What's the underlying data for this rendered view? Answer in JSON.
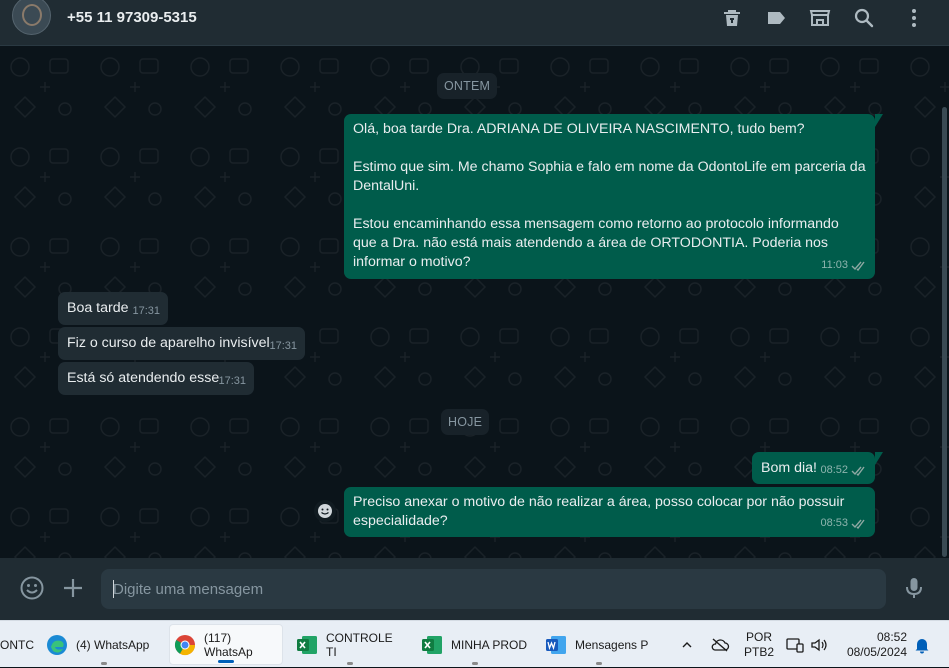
{
  "header": {
    "contact_name": "+55 11 97309-5315",
    "icons": [
      "archive-icon",
      "label-icon",
      "store-icon",
      "search-icon",
      "menu-icon"
    ]
  },
  "chat": {
    "date_yesterday": "ONTEM",
    "date_today": "HOJE",
    "messages": [
      {
        "dir": "out",
        "text": "Olá, boa tarde Dra. ADRIANA DE OLIVEIRA NASCIMENTO, tudo bem?\n\nEstimo que sim. Me chamo Sophia e falo em nome da OdontoLife em parceria da DentalUni.\n\nEstou encaminhando essa mensagem como retorno ao protocolo informando que a Dra. não está mais atendendo a área de ORTODONTIA. Poderia nos informar o motivo?",
        "time": "11:03"
      },
      {
        "dir": "in",
        "text": "Boa tarde",
        "time": "17:31"
      },
      {
        "dir": "in",
        "text": "Fiz o curso de aparelho invisível",
        "time": "17:31"
      },
      {
        "dir": "in",
        "text": "Está só atendendo esse",
        "time": "17:31"
      },
      {
        "dir": "out",
        "text": "Bom dia!",
        "time": "08:52"
      },
      {
        "dir": "out",
        "text": "Preciso anexar o motivo de não realizar a área, posso colocar por não possuir especialidade?",
        "time": "08:53"
      }
    ]
  },
  "composer": {
    "placeholder": "Digite uma mensagem",
    "icons": [
      "emoji-icon",
      "plus-icon",
      "microphone-icon"
    ]
  },
  "taskbar": {
    "items": [
      {
        "label": "ONTC"
      },
      {
        "label": "(4) WhatsApp"
      },
      {
        "label": "(117) WhatsAp"
      },
      {
        "label": "CONTROLE TI"
      },
      {
        "label": "MINHA PROD"
      },
      {
        "label": "Mensagens P"
      }
    ],
    "lang_top": "POR",
    "lang_bottom": "PTB2",
    "time": "08:52",
    "date": "08/05/2024"
  },
  "colors": {
    "header_bg": "#202c33",
    "chat_bg": "#0b141a",
    "outgoing_bubble": "#005c4b",
    "incoming_bubble": "#202c33",
    "tick_read": "#53bdeb"
  }
}
